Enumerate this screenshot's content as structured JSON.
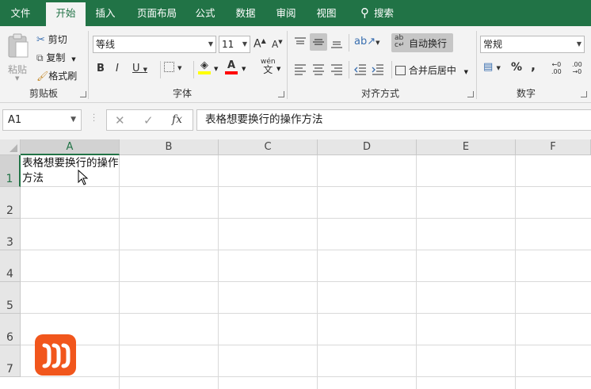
{
  "ribbon_tabs": [
    "文件",
    "开始",
    "插入",
    "页面布局",
    "公式",
    "数据",
    "审阅",
    "视图"
  ],
  "search_label": "搜索",
  "clipboard": {
    "paste": "粘贴",
    "cut": "剪切",
    "copy": "复制",
    "format_painter": "格式刷",
    "group": "剪贴板"
  },
  "font": {
    "name": "等线",
    "size": "11",
    "bold": "B",
    "italic": "I",
    "underline": "U",
    "phonetic": "wén",
    "phonetic_char": "文",
    "group": "字体",
    "font_color": "#ff0000",
    "fill_color": "#ffff00"
  },
  "alignment": {
    "wrap_text": "自动换行",
    "merge_center": "合并后居中",
    "group": "对齐方式",
    "wrap_active": true
  },
  "number": {
    "format": "常规",
    "percent": "%",
    "comma": ",",
    "group": "数字"
  },
  "formula_bar": {
    "name_box": "A1",
    "fx": "fx",
    "content": "表格想要换行的操作方法"
  },
  "sheet": {
    "columns": [
      "A",
      "B",
      "C",
      "D",
      "E",
      "F"
    ],
    "rows": [
      "1",
      "2",
      "3",
      "4",
      "5",
      "6",
      "7"
    ],
    "cell_a1": "表格想要换行的操作方法",
    "selected_cell": "A1"
  },
  "colors": {
    "excel_green": "#217346",
    "logo_orange": "#f1561c"
  }
}
